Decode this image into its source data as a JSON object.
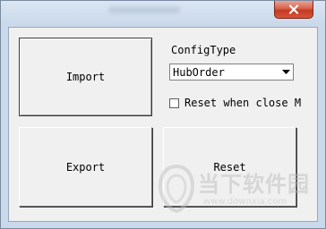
{
  "buttons": {
    "import_label": "Import",
    "export_label": "Export",
    "reset_label": "Reset"
  },
  "config": {
    "label": "ConfigType",
    "selected_value": "HubOrder"
  },
  "checkbox": {
    "label": "Reset when close M",
    "checked": false
  },
  "watermark": {
    "text": "当下软件园",
    "url": "www.downxia.com"
  },
  "colors": {
    "close_button": "#c8432b",
    "client_background": "#f0f0f0",
    "frame": "#c9d8ea"
  },
  "icons": {
    "close": "close-icon",
    "dropdown": "chevron-down-icon"
  }
}
